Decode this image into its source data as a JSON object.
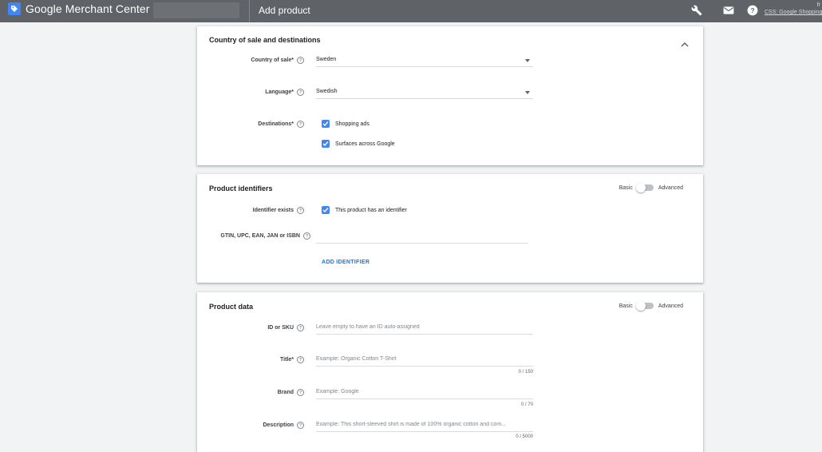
{
  "header": {
    "app_title": "Google Merchant Center",
    "page_title": "Add product",
    "account_line1": "fr",
    "account_link": "CSS: Google Shopping",
    "icons": [
      "tag-logo-icon",
      "wrench-icon",
      "mail-icon",
      "help-icon"
    ]
  },
  "country_card": {
    "title": "Country of sale and destinations",
    "country_label": "Country of sale*",
    "country_value": "Sweden",
    "language_label": "Language*",
    "language_value": "Swedish",
    "destinations_label": "Destinations*",
    "destination_options": [
      "Shopping ads",
      "Surfaces across Google"
    ]
  },
  "identifiers_card": {
    "title": "Product identifiers",
    "toggle_basic": "Basic",
    "toggle_advanced": "Advanced",
    "identifier_exists_label": "Identifier exists",
    "identifier_exists_option": "This product has an identifier",
    "gtin_label": "GTIN, UPC, EAN, JAN or ISBN",
    "add_identifier": "ADD IDENTIFIER"
  },
  "product_card": {
    "title": "Product data",
    "toggle_basic": "Basic",
    "toggle_advanced": "Advanced",
    "id_label": "ID or SKU",
    "id_placeholder": "Leave empty to have an ID auto-assigned",
    "title_label": "Title*",
    "title_placeholder": "Example: Organic Cotton T-Shirt",
    "title_counter": "0 / 150",
    "brand_label": "Brand",
    "brand_placeholder": "Example: Google",
    "brand_counter": "0 / 70",
    "description_label": "Description",
    "description_placeholder": "Example: This short-sleeved shirt is made of 100% organic cotton and com...",
    "description_counter": "0 / 5000"
  },
  "colors": {
    "topbar": "#5f6368",
    "accent": "#4285f4",
    "link": "#1a73e8"
  }
}
